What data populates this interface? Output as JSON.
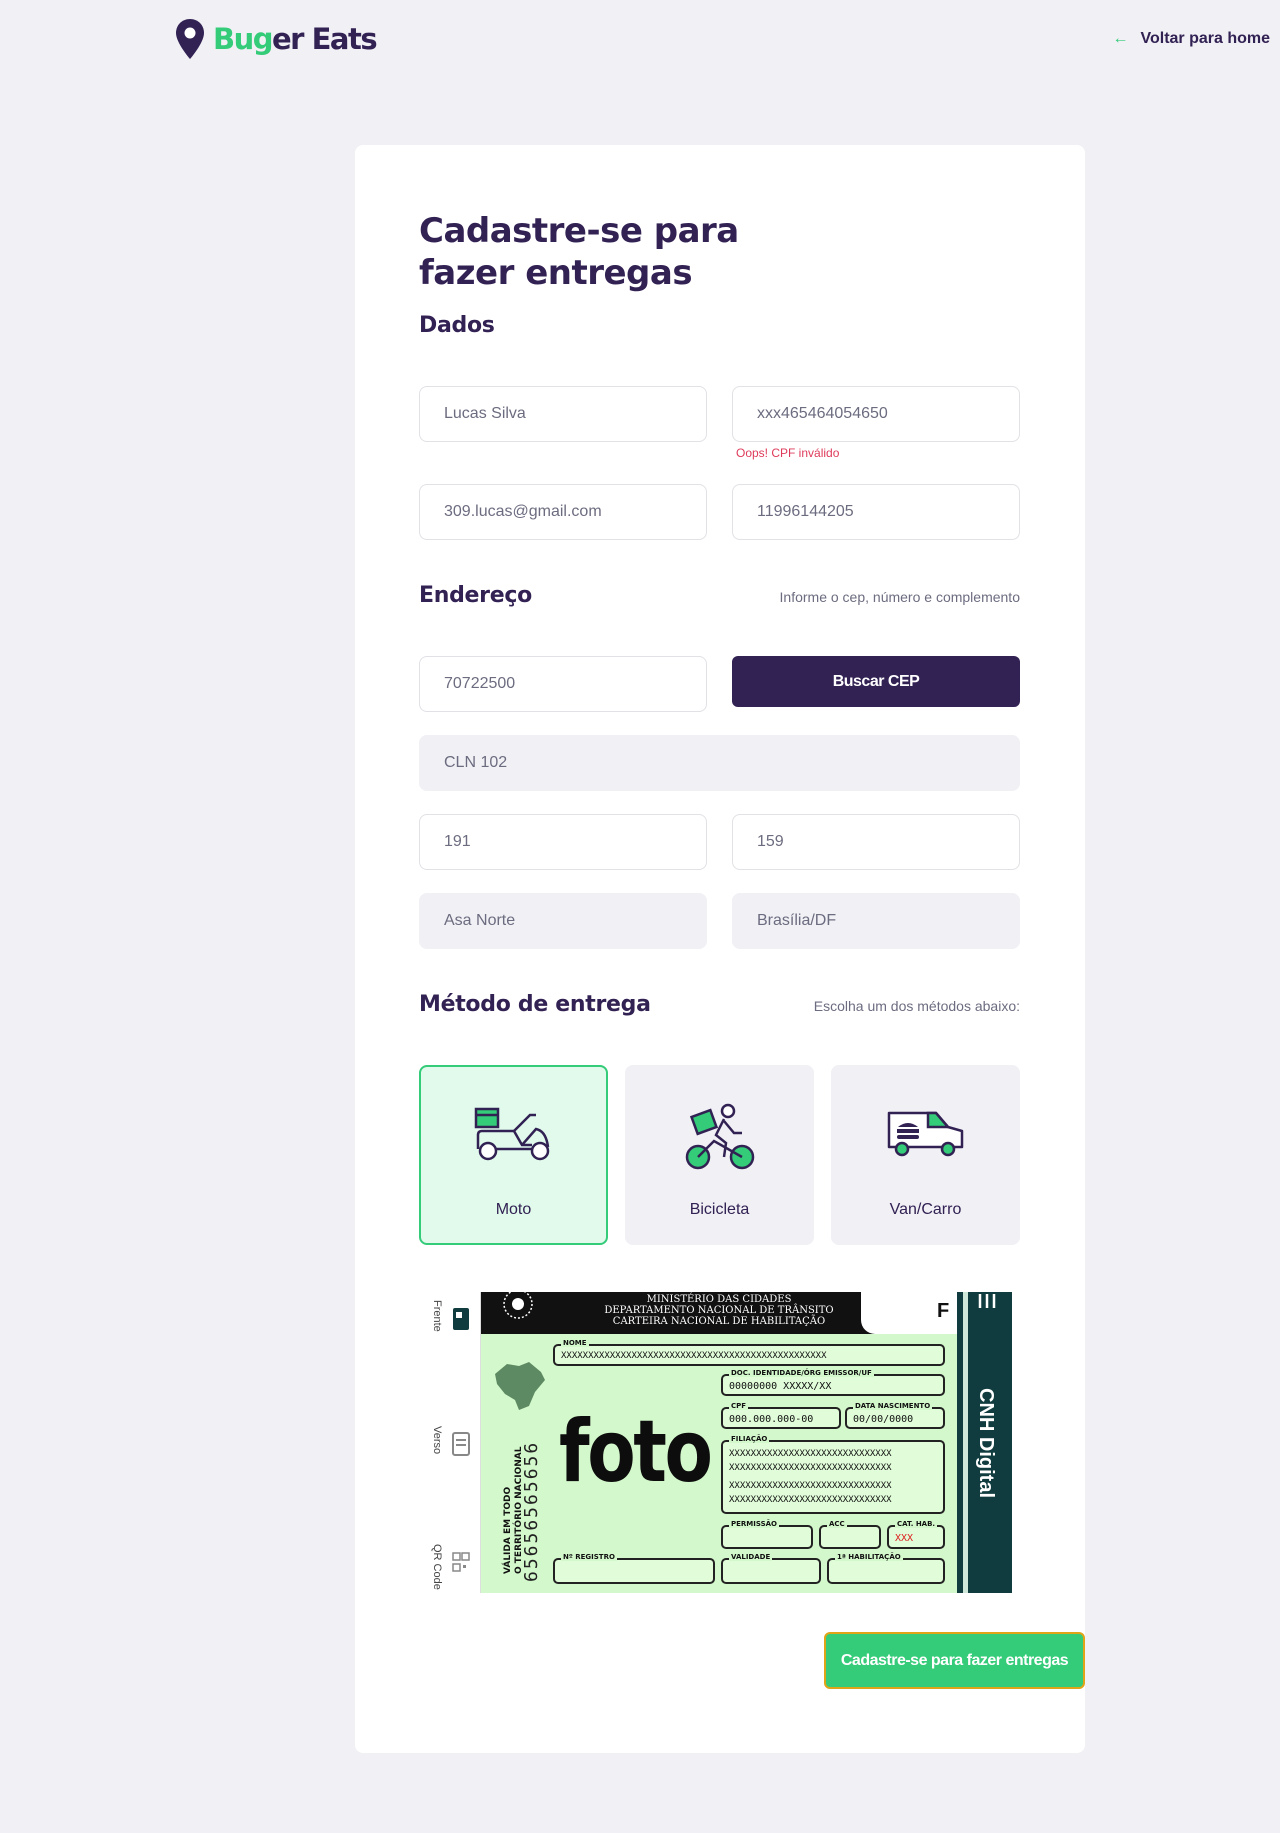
{
  "header": {
    "brand_part1": "Bu",
    "brand_part2": "g",
    "brand_part3": "er Eats",
    "back_label": "Voltar para home"
  },
  "form": {
    "title": "Cadastre-se para fazer entregas",
    "dados": {
      "heading": "Dados",
      "name": "Lucas Silva",
      "cpf": "xxx465464054650",
      "cpf_error": "Oops! CPF inválido",
      "email": "309.lucas@gmail.com",
      "whatsapp": "11996144205"
    },
    "endereco": {
      "heading": "Endereço",
      "hint": "Informe o cep, número e complemento",
      "cep": "70722500",
      "cep_button": "Buscar CEP",
      "street": "CLN 102",
      "number": "191",
      "complement": "159",
      "district": "Asa Norte",
      "city": "Brasília/DF"
    },
    "metodo": {
      "heading": "Método de entrega",
      "hint": "Escolha um dos métodos abaixo:",
      "options": [
        {
          "label": "Moto",
          "icon": "scooter-icon",
          "selected": true
        },
        {
          "label": "Bicicleta",
          "icon": "bicycle-icon",
          "selected": false
        },
        {
          "label": "Van/Carro",
          "icon": "van-icon",
          "selected": false
        }
      ]
    },
    "cnh": {
      "side_front": "Frente",
      "side_back": "Verso",
      "side_qr": "QR Code",
      "header_line1": "MINISTÉRIO DAS CIDADES",
      "header_line2": "DEPARTAMENTO NACIONAL DE TRÂNSITO",
      "header_line3": "CARTEIRA NACIONAL DE HABILITAÇÃO",
      "corner_letter": "F",
      "nome_label": "NOME",
      "nome_value": "XXXXXXXXXXXXXXXXXXXXXXXXXXXXXXXXXXXXXXXXXXXXXXXXX",
      "doc_label": "DOC. IDENTIDADE/ÓRG EMISSOR/UF",
      "doc_value": "00000000  XXXXX/XX",
      "cpf_label": "CPF",
      "cpf_value": "000.000.000-00",
      "nasc_label": "DATA NASCIMENTO",
      "nasc_value": "00/00/0000",
      "filiacao_label": "FILIAÇÃO",
      "filiacao_values": [
        "XXXXXXXXXXXXXXXXXXXXXXXXXXXXXX",
        "XXXXXXXXXXXXXXXXXXXXXXXXXXXXXX",
        "XXXXXXXXXXXXXXXXXXXXXXXXXXXXXX",
        "XXXXXXXXXXXXXXXXXXXXXXXXXXXXXX"
      ],
      "permissao_label": "PERMISSÃO",
      "acc_label": "ACC",
      "cat_label": "CAT. HAB.",
      "cat_value": "XXX",
      "registro_label": "Nº REGISTRO",
      "validade_label": "VALIDADE",
      "habilitacao_label": "1ª HABILITAÇÃO",
      "foto_text": "foto",
      "valid_text_line1": "VÁLIDA EM TODO",
      "valid_text_line2": "O TERRITÓRIO NACIONAL",
      "reg_number": "65656565656",
      "digital_label": "CNH Digital"
    },
    "submit_label": "Cadastre-se para fazer entregas"
  },
  "colors": {
    "primary": "#322153",
    "accent": "#34cb79",
    "error": "#de3b5a",
    "background": "#f0f0f5"
  }
}
